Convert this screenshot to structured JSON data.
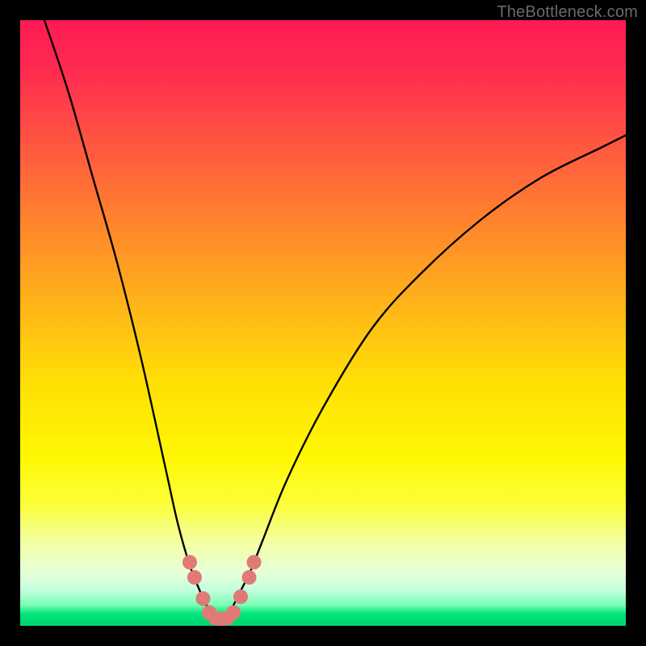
{
  "watermark": "TheBottleneck.com",
  "chart_data": {
    "type": "line",
    "title": "",
    "xlabel": "",
    "ylabel": "",
    "xlim": [
      0,
      100
    ],
    "ylim": [
      0,
      100
    ],
    "grid": false,
    "legend": false,
    "note": "Axes are percent of plot area; curve is a V-shaped bottleneck profile with minimum near x≈33.",
    "series": [
      {
        "name": "bottleneck-curve",
        "color": "#000000",
        "x": [
          4,
          8,
          12,
          16,
          20,
          24,
          26,
          28,
          30,
          31,
          32,
          33,
          34,
          35,
          36,
          38,
          40,
          44,
          50,
          58,
          66,
          76,
          86,
          96,
          100
        ],
        "y": [
          100,
          88,
          74,
          60,
          44,
          26,
          17,
          10,
          5,
          3,
          1.5,
          1,
          1.5,
          3,
          5,
          9,
          14,
          24,
          36,
          49,
          58,
          67,
          74,
          79,
          81
        ]
      }
    ],
    "markers": [
      {
        "name": "left-dot-upper",
        "x": 28.0,
        "y": 10.5,
        "color": "#e07a76",
        "r": 9
      },
      {
        "name": "left-dot-lower",
        "x": 28.8,
        "y": 8.0,
        "color": "#e07a76",
        "r": 9
      },
      {
        "name": "left-dot-near",
        "x": 30.2,
        "y": 4.5,
        "color": "#e07a76",
        "r": 9
      },
      {
        "name": "bottom-dot-1",
        "x": 31.2,
        "y": 2.2,
        "color": "#e07a76",
        "r": 9
      },
      {
        "name": "bottom-dot-2",
        "x": 32.2,
        "y": 1.3,
        "color": "#e07a76",
        "r": 9
      },
      {
        "name": "bottom-dot-3",
        "x": 33.2,
        "y": 1.1,
        "color": "#e07a76",
        "r": 9
      },
      {
        "name": "bottom-dot-4",
        "x": 34.2,
        "y": 1.3,
        "color": "#e07a76",
        "r": 9
      },
      {
        "name": "bottom-dot-5",
        "x": 35.2,
        "y": 2.2,
        "color": "#e07a76",
        "r": 9
      },
      {
        "name": "right-dot-near",
        "x": 36.4,
        "y": 4.8,
        "color": "#e07a76",
        "r": 9
      },
      {
        "name": "right-dot-lower",
        "x": 37.8,
        "y": 8.0,
        "color": "#e07a76",
        "r": 9
      },
      {
        "name": "right-dot-upper",
        "x": 38.6,
        "y": 10.5,
        "color": "#e07a76",
        "r": 9
      }
    ]
  }
}
